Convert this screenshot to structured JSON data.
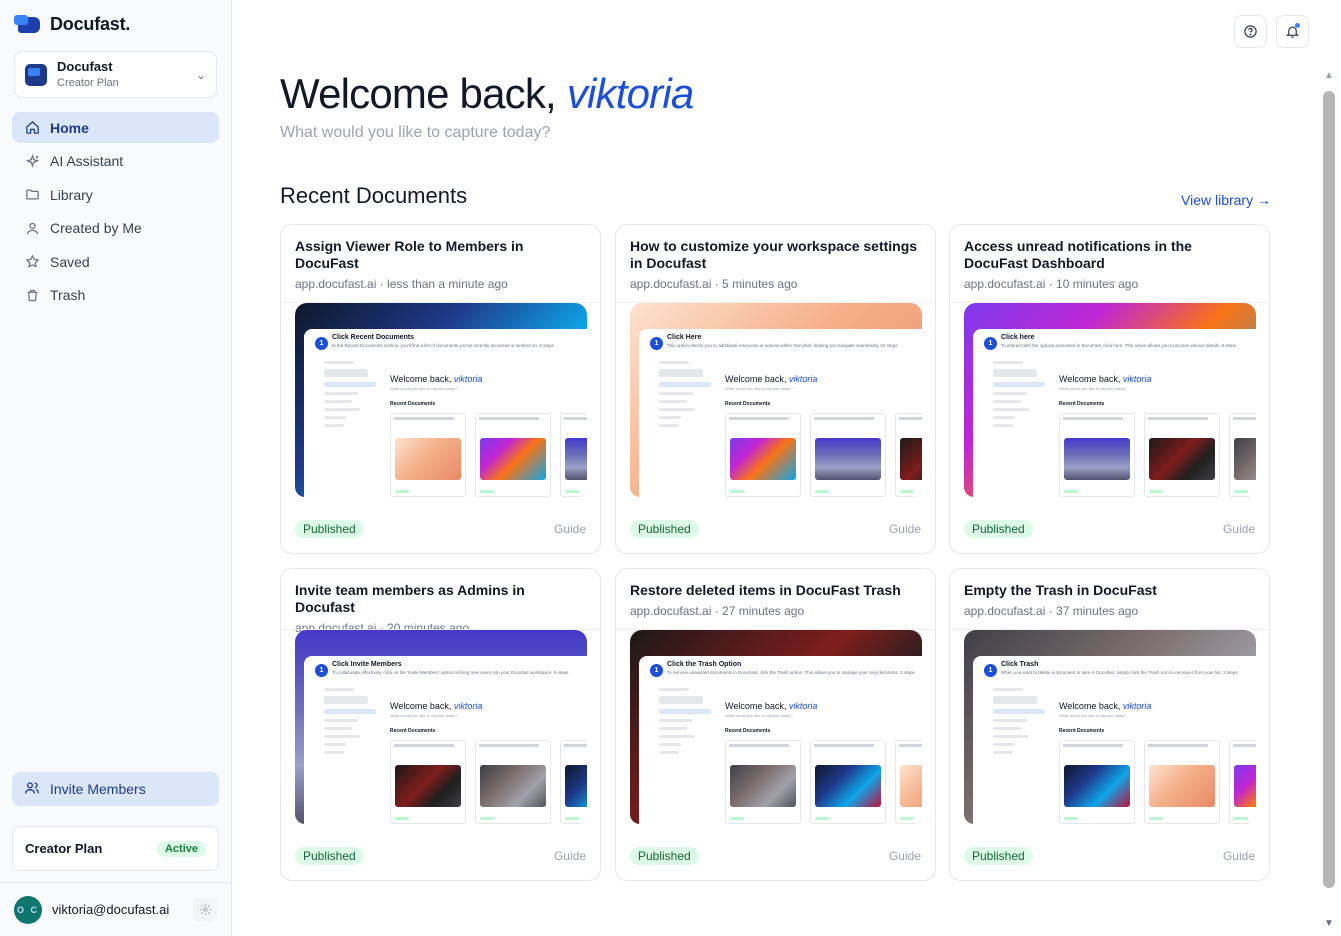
{
  "brand": {
    "name": "Docufast."
  },
  "workspace": {
    "name": "Docufast",
    "plan": "Creator Plan"
  },
  "nav": [
    {
      "label": "Home",
      "icon": "home-icon",
      "active": true
    },
    {
      "label": "AI Assistant",
      "icon": "sparkle-icon",
      "active": false
    },
    {
      "label": "Library",
      "icon": "folder-icon",
      "active": false
    },
    {
      "label": "Created by Me",
      "icon": "user-icon",
      "active": false
    },
    {
      "label": "Saved",
      "icon": "star-icon",
      "active": false
    },
    {
      "label": "Trash",
      "icon": "trash-icon",
      "active": false
    }
  ],
  "invite": {
    "label": "Invite Members"
  },
  "plan_card": {
    "name": "Creator Plan",
    "status": "Active"
  },
  "user": {
    "email": "viktoria@docufast.ai",
    "initials": "O C"
  },
  "main": {
    "welcome_prefix": "Welcome back, ",
    "username": "viktoria",
    "subtitle": "What would you like to capture today?",
    "section_title": "Recent Documents",
    "view_library": "View library →"
  },
  "cards": [
    {
      "title": "Assign Viewer Role to Members in DocuFast",
      "meta": "app.docufast.ai · less than a minute ago",
      "status": "Published",
      "type": "Guide",
      "step_title": "Click Recent Documents",
      "step_desc": "In the Recent Documents section, you'll find a list of documents you've recently accessed or worked on. 5 steps",
      "gradient": "linear-gradient(135deg, #0f172a 0%, #1e3a8a 35%, #0ea5e9 65%, #be123c 100%)"
    },
    {
      "title": "How to customize your workspace settings in Docufast",
      "meta": "app.docufast.ai · 5 minutes ago",
      "status": "Published",
      "type": "Guide",
      "step_title": "Click Here",
      "step_desc": "This option directs you to additional resources or actions within Docufast, helping you navigate seamlessly. 10 steps",
      "gradient": "linear-gradient(135deg, #fde2cf 0%, #f5b08a 45%, #e88a66 100%)"
    },
    {
      "title": "Access unread notifications in the DocuFast Dashboard",
      "meta": "app.docufast.ai · 10 minutes ago",
      "status": "Published",
      "type": "Guide",
      "step_title": "Click here",
      "step_desc": "To interact with the options presented in DocuFast, click here. This action allows you to access various details. 8 steps",
      "gradient": "linear-gradient(135deg, #7c3aed 0%, #c026d3 30%, #f97316 55%, #0ea5e9 100%)"
    },
    {
      "title": "Invite team members as Admins in Docufast",
      "meta": "app.docufast.ai · 20 minutes ago",
      "status": "Published",
      "type": "Guide",
      "step_title": "Click Invite Members",
      "step_desc": "To collaborate effectively, click on the 'Invite Members' option to bring new users into your Docufast workspace. 6 steps",
      "gradient": "linear-gradient(180deg, #4338ca 0%, #6d6fb8 40%, #9aa0c8 70%, #52526e 100%)"
    },
    {
      "title": "Restore deleted items in DocuFast Trash",
      "meta": "app.docufast.ai · 27 minutes ago",
      "status": "Published",
      "type": "Guide",
      "step_title": "Click the Trash Option",
      "step_desc": "To remove unwanted documents in DocuFast, click the Trash option. This allows you to manage your recycled items. 2 steps",
      "gradient": "linear-gradient(135deg, #1c1917 0%, #7f1d1d 45%, #1f1f1f 70%, #3f3f46 100%)"
    },
    {
      "title": "Empty the Trash in DocuFast",
      "meta": "app.docufast.ai · 37 minutes ago",
      "status": "Published",
      "type": "Guide",
      "step_title": "Click Trash",
      "step_desc": "When you want to delete a document or item in Docufast, simply click the Trash icon to remove it from your list. 3 steps",
      "gradient": "linear-gradient(135deg, #3f3f46 0%, #7c6f6f 40%, #a1a1aa 70%, #52525b 100%)"
    }
  ],
  "colors": {
    "accent": "#1d4ed8",
    "active_nav_bg": "#dbe7f9",
    "published_bg": "#dcfce7"
  }
}
